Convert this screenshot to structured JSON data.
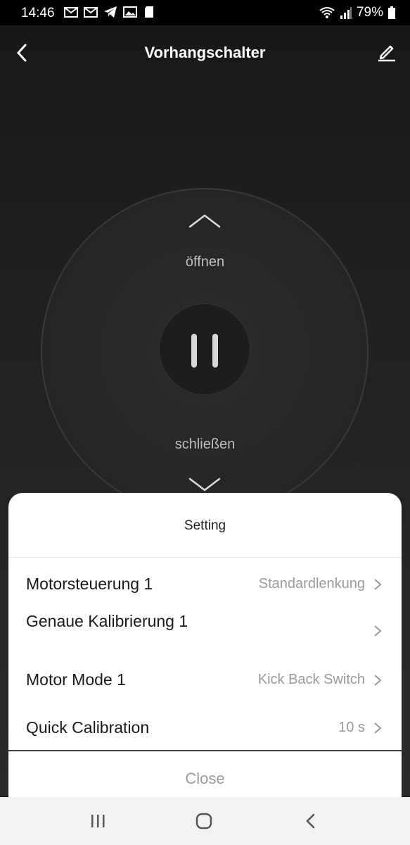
{
  "status_bar": {
    "time": "14:46",
    "battery": "79%"
  },
  "header": {
    "title": "Vorhangschalter"
  },
  "control": {
    "open_label": "öffnen",
    "close_label": "schließen"
  },
  "sheet": {
    "title": "Setting",
    "rows": [
      {
        "label": "Motorsteuerung 1",
        "value": "Standardlenkung"
      },
      {
        "label": "Genaue Kalibrierung 1",
        "value": ""
      },
      {
        "label": "Motor Mode 1",
        "value": "Kick Back Switch"
      },
      {
        "label": "Quick Calibration",
        "value": "10 s"
      }
    ],
    "close_label": "Close"
  },
  "icons": {
    "back": "chevron-left-icon",
    "edit": "pencil-icon",
    "open": "chevron-up-icon",
    "close": "chevron-down-icon",
    "pause": "pause-icon"
  }
}
